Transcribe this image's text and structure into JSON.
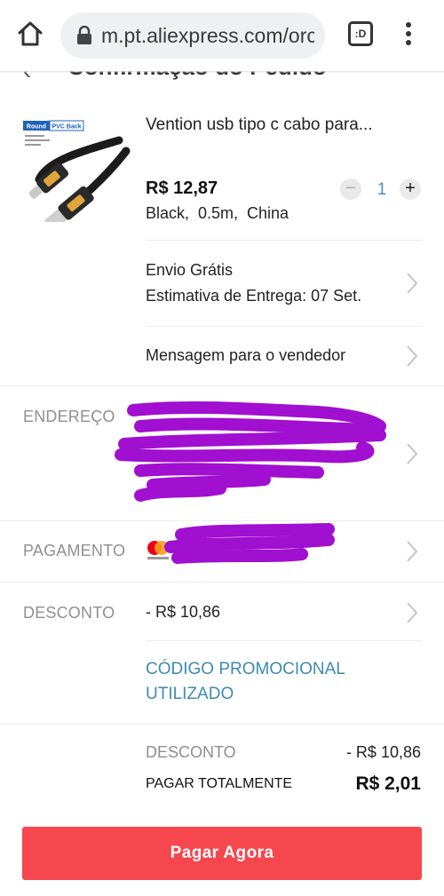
{
  "browser": {
    "url": "m.pt.aliexpress.com/orc",
    "tab_count": ":D"
  },
  "header": {
    "title": "Confirmação do Pedido"
  },
  "product": {
    "title": "Vention usb tipo c cabo para...",
    "price": "R$ 12,87",
    "quantity": "1",
    "qty_minus": "−",
    "qty_plus": "+",
    "variant": "Black,  0.5m,  China",
    "image_badge_left": "Round",
    "image_badge_right": "PVC Back"
  },
  "shipping": {
    "line1": "Envio Grátis",
    "line2": "Estimativa de Entrega: 07 Set."
  },
  "message": {
    "label": "Mensagem para o vendedor"
  },
  "address": {
    "label": "ENDEREÇO"
  },
  "payment": {
    "label": "PAGAMENTO"
  },
  "discount": {
    "label": "DESCONTO",
    "value": "- R$ 10,86",
    "promo_line1": "CÓDIGO PROMOCIONAL",
    "promo_line2": "UTILIZADO"
  },
  "summary": {
    "discount_label": "DESCONTO",
    "discount_value": "- R$ 10,86",
    "total_label": "PAGAR TOTALMENTE",
    "total_value": "R$ 2,01"
  },
  "actions": {
    "pay_now": "Pagar Agora"
  },
  "colors": {
    "accent": "#f5474d",
    "promo": "#3d8ab0",
    "redaction": "#a10fd0"
  }
}
